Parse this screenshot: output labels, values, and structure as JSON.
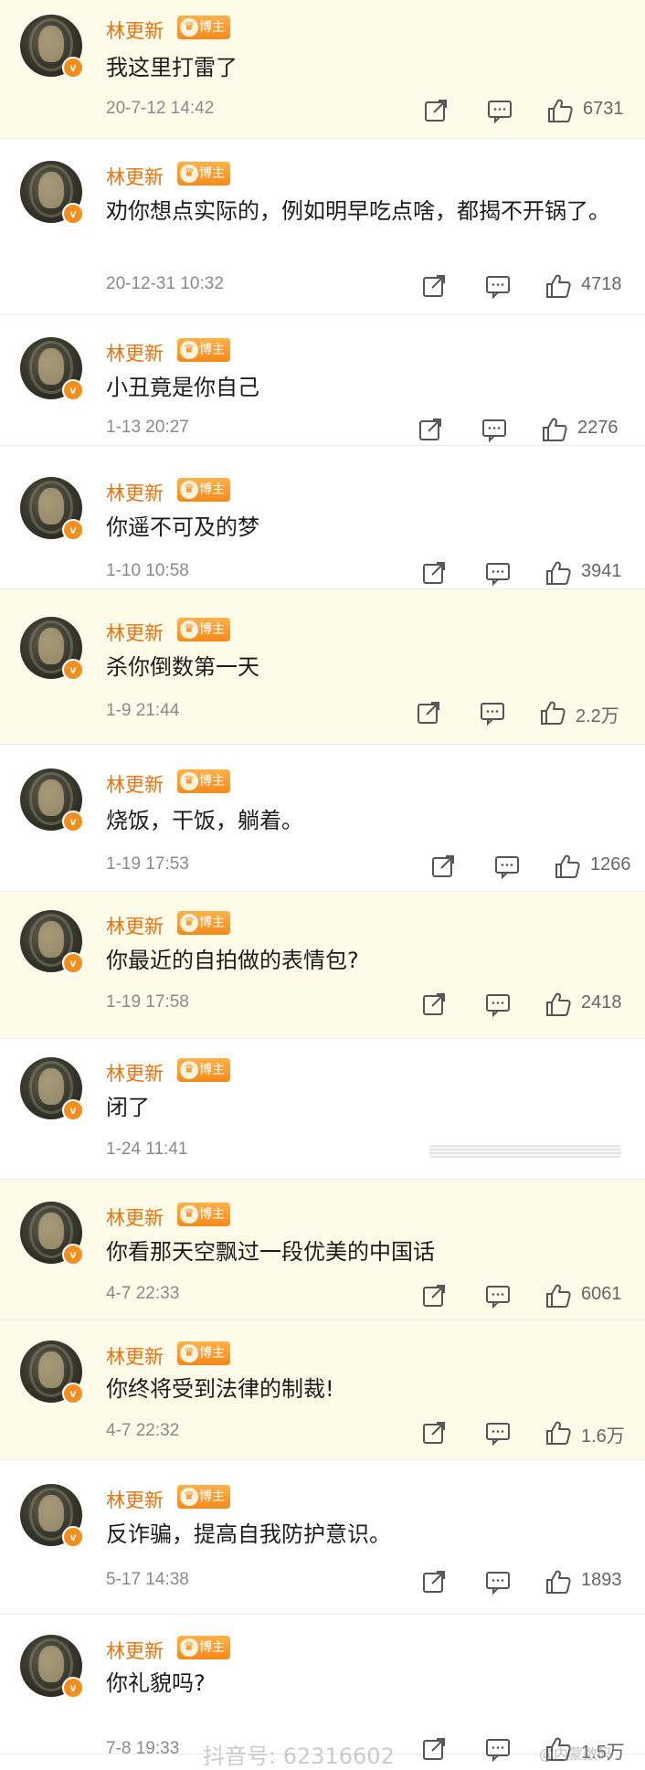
{
  "colors": {
    "username": "#e8720c",
    "highlight_bg": "#fefbe8",
    "badge": "#f48a1a",
    "meta": "#8a8a8a"
  },
  "comments": [
    {
      "author": "林更新",
      "badge": "博主",
      "text": "我这里打雷了",
      "time": "20-7-12 14:42",
      "likes": "6731",
      "highlighted": true
    },
    {
      "author": "林更新",
      "badge": "博主",
      "text": "劝你想点实际的，例如明早吃点啥，都揭不开锅了。",
      "time": "20-12-31 10:32",
      "likes": "4718",
      "highlighted": false
    },
    {
      "author": "林更新",
      "badge": "博主",
      "text": "小丑竟是你自己",
      "time": "1-13 20:27",
      "likes": "2276",
      "highlighted": false
    },
    {
      "author": "林更新",
      "badge": "博主",
      "text": "你遥不可及的梦",
      "time": "1-10 10:58",
      "likes": "3941",
      "highlighted": false
    },
    {
      "author": "林更新",
      "badge": "博主",
      "text": "杀你倒数第一天",
      "time": "1-9 21:44",
      "likes": "2.2万",
      "highlighted": true
    },
    {
      "author": "林更新",
      "badge": "博主",
      "text": "烧饭，干饭，躺着。",
      "time": "1-19 17:53",
      "likes": "1266",
      "highlighted": false
    },
    {
      "author": "林更新",
      "badge": "博主",
      "text": "你最近的自拍做的表情包?",
      "time": "1-19 17:58",
      "likes": "2418",
      "highlighted": true
    },
    {
      "author": "林更新",
      "badge": "博主",
      "text": "闭了",
      "time": "1-24 11:41",
      "likes": "",
      "highlighted": false
    },
    {
      "author": "林更新",
      "badge": "博主",
      "text": "你看那天空飘过一段优美的中国话",
      "time": "4-7 22:33",
      "likes": "6061",
      "highlighted": true
    },
    {
      "author": "林更新",
      "badge": "博主",
      "text": "你终将受到法律的制裁!",
      "time": "4-7 22:32",
      "likes": "1.6万",
      "highlighted": true
    },
    {
      "author": "林更新",
      "badge": "博主",
      "text": "反诈骗，提高自我防护意识。",
      "time": "5-17 14:38",
      "likes": "1893",
      "highlighted": false
    },
    {
      "author": "林更新",
      "badge": "博主",
      "text": "你礼貌吗?",
      "time": "7-8 19:33",
      "likes": "1.5万",
      "highlighted": false
    }
  ],
  "watermarks": {
    "douyin": "抖音号: 62316602",
    "weibo": "@内蒙数码"
  },
  "icons": {
    "repost": "repost-icon",
    "comment": "comment-icon",
    "like": "thumbs-up-icon",
    "verified": "v-verified-icon",
    "badge": "crown-icon"
  }
}
